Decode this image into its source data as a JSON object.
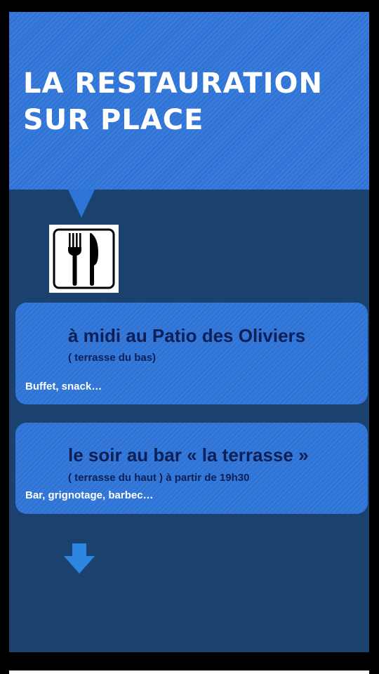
{
  "header": {
    "title_line1": "LA RESTAURATION",
    "title_line2": "SUR PLACE"
  },
  "icon": {
    "name": "fork-knife-icon"
  },
  "cards": [
    {
      "title": "à midi au Patio des Oliviers",
      "subtitle": "( terrasse du bas)",
      "description": "Buffet, snack…"
    },
    {
      "title": "le soir au bar « la terrasse »",
      "subtitle": "( terrasse du haut ) à partir de 19h30",
      "description": "Bar, grignotage, barbec…"
    }
  ],
  "footer": {
    "icon": "arrow-down-icon"
  },
  "colors": {
    "header_blue": "#2e73d6",
    "background_navy": "#1b416f",
    "card_title": "#0d1f57",
    "text_white": "#ffffff"
  }
}
